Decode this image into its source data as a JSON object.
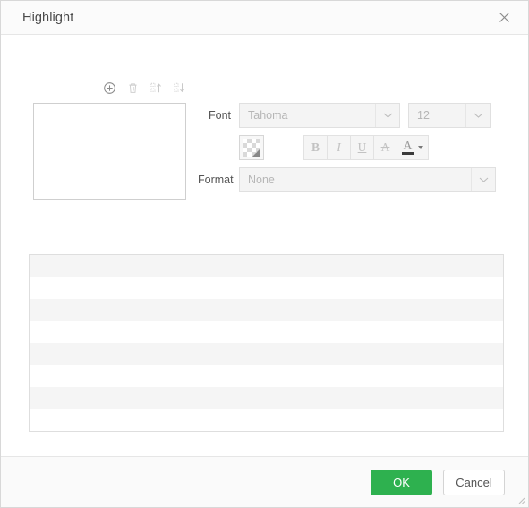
{
  "dialog": {
    "title": "Highlight",
    "close_icon": "close-icon"
  },
  "toolbar": {
    "icons": [
      {
        "name": "add-icon",
        "label": "Add",
        "disabled": false
      },
      {
        "name": "delete-icon",
        "label": "Delete",
        "disabled": true
      },
      {
        "name": "move-up-icon",
        "label": "Move Up",
        "disabled": true
      },
      {
        "name": "move-down-icon",
        "label": "Move Down",
        "disabled": true
      }
    ]
  },
  "preview": {
    "name": "highlight-items-list",
    "content": ""
  },
  "form": {
    "font_label": "Font",
    "font_name_value": "Tahoma",
    "font_size_value": "12",
    "format_label": "Format",
    "format_value": "None",
    "dropdown_icon": "chevron-down-icon",
    "color_swatch": {
      "name": "highlight-color-swatch",
      "value": "transparent"
    },
    "style_buttons": [
      {
        "name": "bold-button",
        "label": "B",
        "style": "bold"
      },
      {
        "name": "italic-button",
        "label": "I",
        "style": "italic"
      },
      {
        "name": "underline-button",
        "label": "U",
        "style": "under"
      },
      {
        "name": "strikethrough-button",
        "label": "A",
        "style": "strike"
      }
    ],
    "font_color_button": {
      "name": "font-color-button",
      "label": "A",
      "bar_color": "#3b3b3b"
    }
  },
  "table": {
    "name": "highlight-rules-table",
    "rows": [
      {
        "striped": true
      },
      {
        "striped": false
      },
      {
        "striped": true
      },
      {
        "striped": false
      },
      {
        "striped": true
      },
      {
        "striped": false
      },
      {
        "striped": true
      },
      {
        "striped": false
      }
    ]
  },
  "footer": {
    "ok_label": "OK",
    "cancel_label": "Cancel",
    "resize_grip": "resize-grip-icon"
  },
  "colors": {
    "accent_ok": "#2eb14f",
    "border": "#e0e0e0",
    "disabled_text": "#b6b6b6",
    "stripe": "#f5f5f5"
  }
}
